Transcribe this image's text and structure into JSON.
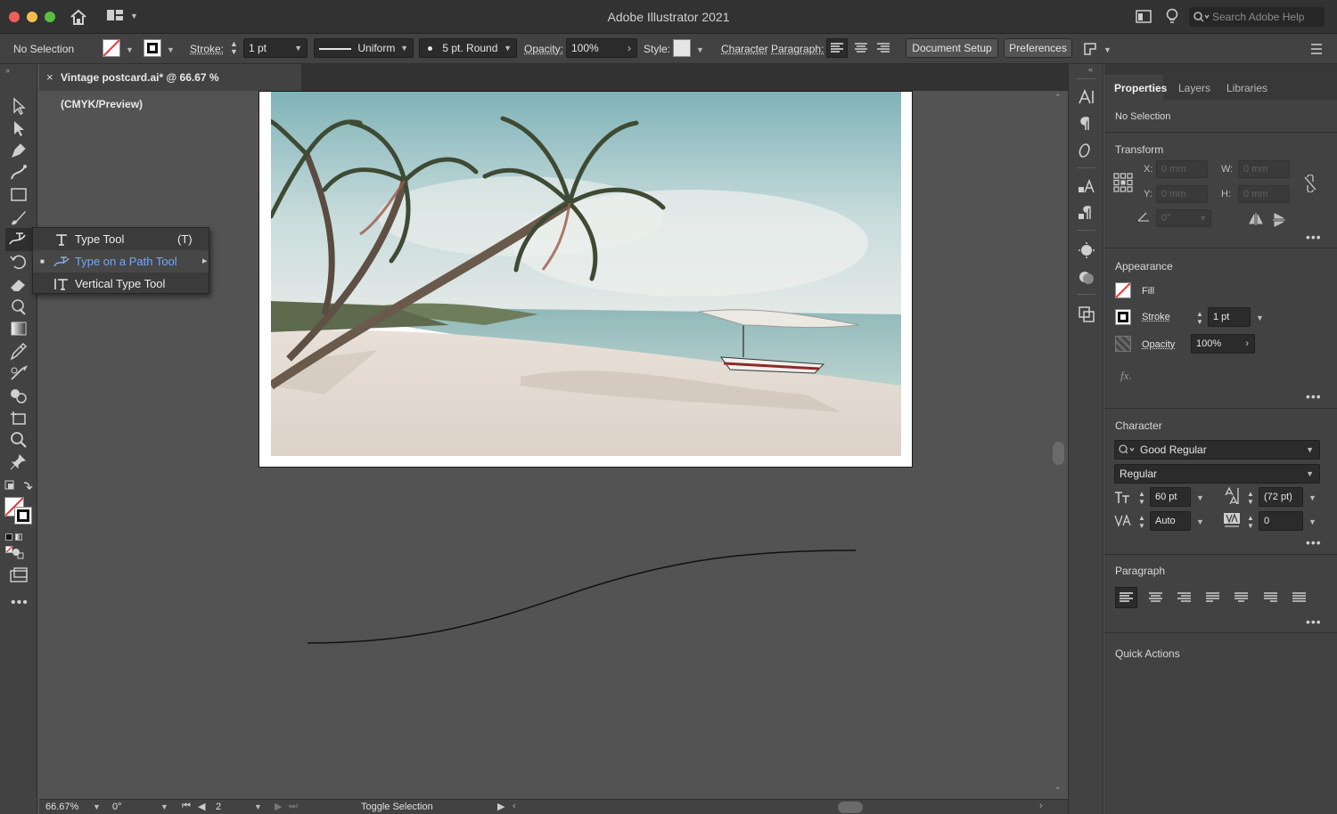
{
  "app": {
    "title": "Adobe Illustrator 2021",
    "search_placeholder": "Search Adobe Help"
  },
  "control_bar": {
    "selection": "No Selection",
    "stroke_label": "Stroke:",
    "stroke_value": "1 pt",
    "profile": "Uniform",
    "brush": "5 pt. Round",
    "opacity_label": "Opacity:",
    "opacity_value": "100%",
    "style_label": "Style:",
    "character_label": "Character",
    "paragraph_label": "Paragraph:",
    "document_setup": "Document Setup",
    "preferences": "Preferences"
  },
  "document": {
    "tab_title": "Vintage postcard.ai* @ 66.67 % (CMYK/Preview)"
  },
  "flyout": {
    "items": [
      {
        "label": "Type Tool",
        "shortcut": "(T)",
        "icon": "type-icon"
      },
      {
        "label": "Type on a Path Tool",
        "icon": "type-on-path-icon"
      },
      {
        "label": "Vertical Type Tool",
        "icon": "vertical-type-icon"
      }
    ]
  },
  "status_bar": {
    "zoom": "66.67%",
    "rotation": "0°",
    "artboard": "2",
    "mode": "Toggle Selection"
  },
  "panel": {
    "tabs": [
      "Properties",
      "Layers",
      "Libraries"
    ],
    "selection": "No Selection",
    "transform": {
      "title": "Transform",
      "x_label": "X:",
      "y_label": "Y:",
      "w_label": "W:",
      "h_label": "H:",
      "x": "0 mm",
      "y": "0 mm",
      "w": "0 mm",
      "h": "0 mm",
      "angle": "0°"
    },
    "appearance": {
      "title": "Appearance",
      "fill": "Fill",
      "stroke": "Stroke",
      "stroke_value": "1 pt",
      "opacity": "Opacity",
      "opacity_value": "100%",
      "fx": "fx."
    },
    "character": {
      "title": "Character",
      "font": "Good Regular",
      "style": "Regular",
      "size": "60 pt",
      "leading": "(72 pt)",
      "kerning": "Auto",
      "tracking": "0"
    },
    "paragraph": {
      "title": "Paragraph"
    },
    "quick_actions": {
      "title": "Quick Actions"
    }
  },
  "colors": {
    "accent": "#6fa8ff",
    "traffic_red": "#ee5f57",
    "traffic_yellow": "#f5bd4f",
    "traffic_green": "#58c03e"
  }
}
